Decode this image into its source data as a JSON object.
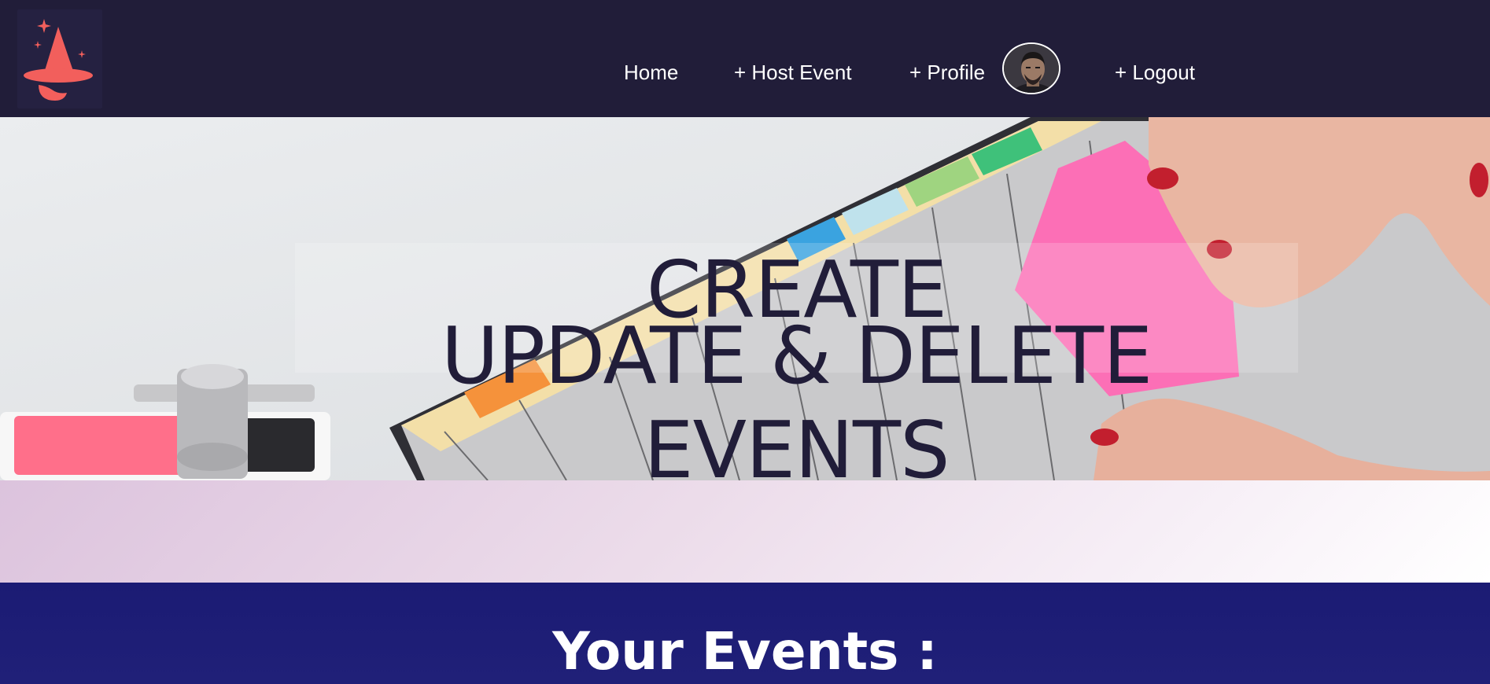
{
  "nav": {
    "items": [
      {
        "label": "Home"
      },
      {
        "label": "+ Host Event"
      },
      {
        "label": "+ Profile"
      },
      {
        "label": "+ Logout"
      }
    ]
  },
  "hero": {
    "line1": "CREATE",
    "line2": "UPDATE & DELETE EVENTS"
  },
  "events": {
    "heading": "Your Events :"
  },
  "colors": {
    "navbar_bg": "#211d39",
    "logo_accent": "#f25f5c",
    "hero_text": "#211d39",
    "events_bg": "#1b1b74"
  },
  "icons": {
    "logo": "wizard-hat-icon",
    "avatar": "user-avatar"
  }
}
